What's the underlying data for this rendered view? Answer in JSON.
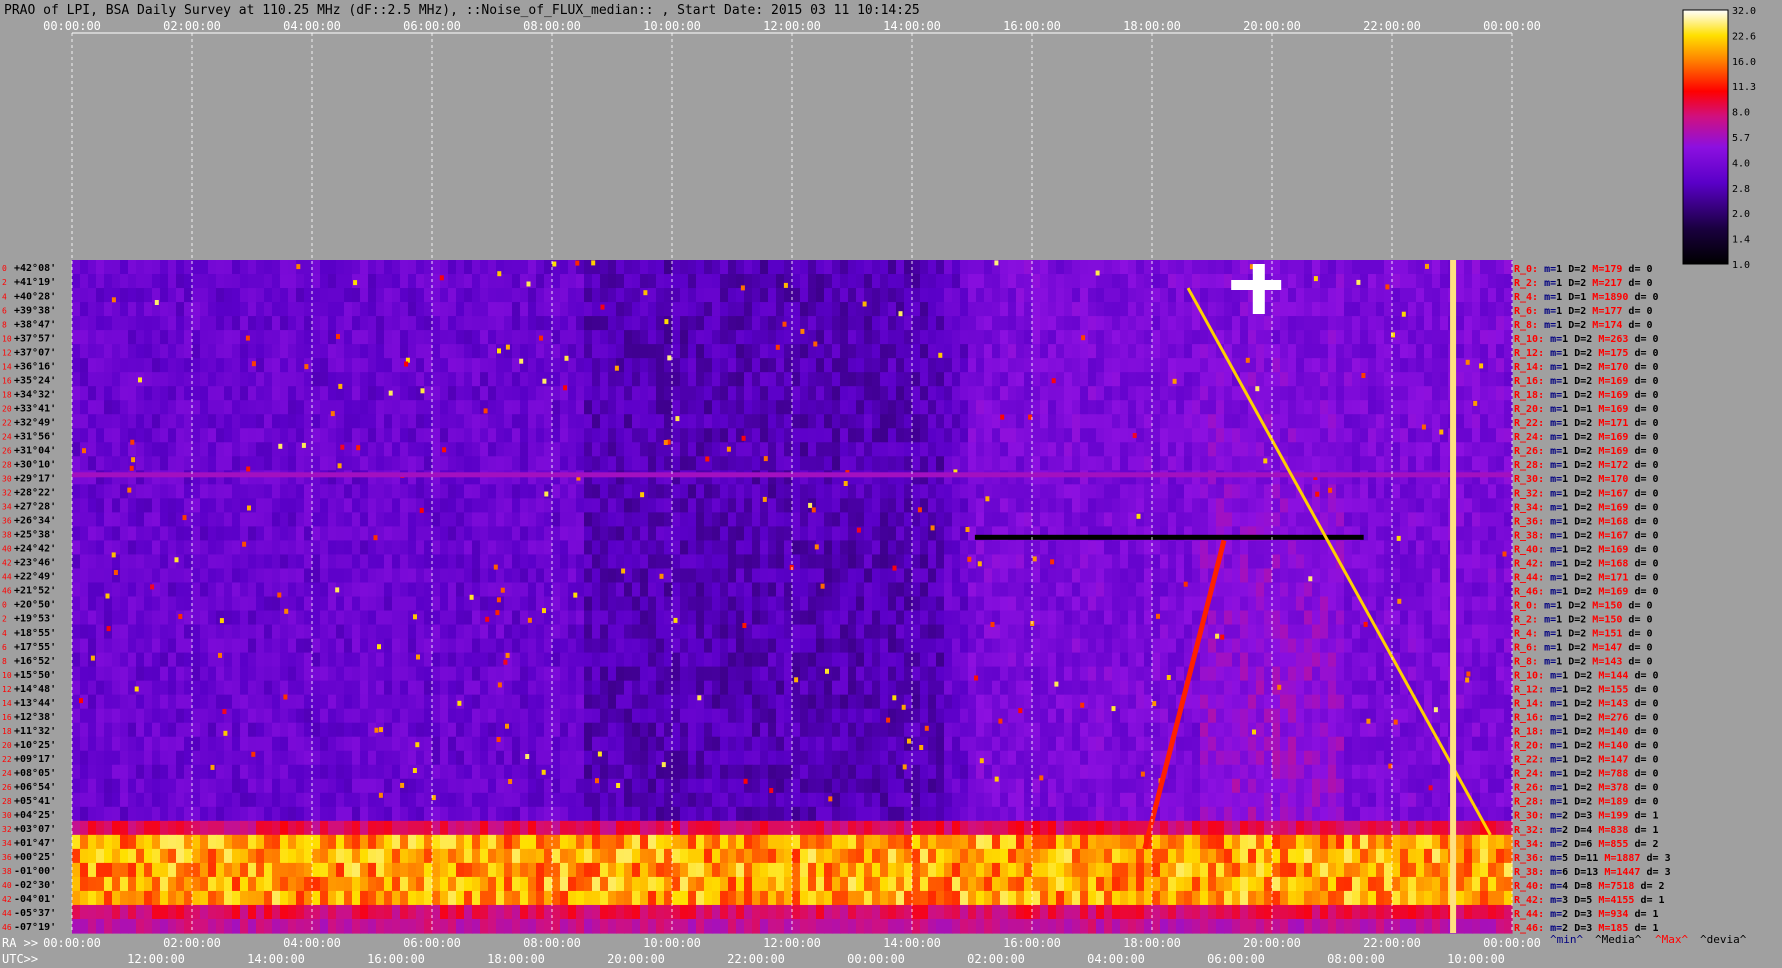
{
  "chart_data": {
    "type": "heatmap",
    "title": "PRAO of LPI, BSA Daily Survey at 110.25 MHz (dF::2.5 MHz), ::Noise_of_FLUX_median:: , Start Date: 2015 03 11 10:14:25",
    "x_top_ticks": [
      "00:00:00",
      "02:00:00",
      "04:00:00",
      "06:00:00",
      "08:00:00",
      "10:00:00",
      "12:00:00",
      "14:00:00",
      "16:00:00",
      "18:00:00",
      "20:00:00",
      "22:00:00",
      "00:00:00"
    ],
    "x_ra_label": "RA >>",
    "x_ra_ticks": [
      "00:00:00",
      "02:00:00",
      "04:00:00",
      "06:00:00",
      "08:00:00",
      "10:00:00",
      "12:00:00",
      "14:00:00",
      "16:00:00",
      "18:00:00",
      "20:00:00",
      "22:00:00",
      "00:00:00"
    ],
    "x_utc_label": "UTC>>",
    "x_utc_ticks": [
      "12:00:00",
      "14:00:00",
      "16:00:00",
      "18:00:00",
      "20:00:00",
      "22:00:00",
      "00:00:00",
      "02:00:00",
      "04:00:00",
      "06:00:00",
      "08:00:00",
      "10:00:00"
    ],
    "dec_labels": [
      "+42°08'",
      "+41°19'",
      "+40°28'",
      "+39°38'",
      "+38°47'",
      "+37°57'",
      "+37°07'",
      "+36°16'",
      "+35°24'",
      "+34°32'",
      "+33°41'",
      "+32°49'",
      "+31°56'",
      "+31°04'",
      "+30°10'",
      "+29°17'",
      "+28°22'",
      "+27°28'",
      "+26°34'",
      "+25°38'",
      "+24°42'",
      "+23°46'",
      "+22°49'",
      "+21°52'",
      "+20°50'",
      "+19°53'",
      "+18°55'",
      "+17°55'",
      "+16°52'",
      "+15°50'",
      "+14°48'",
      "+13°44'",
      "+12°38'",
      "+11°32'",
      "+10°25'",
      "+09°17'",
      "+08°05'",
      "+06°54'",
      "+05°41'",
      "+04°25'",
      "+03°07'",
      "+01°47'",
      "+00°25'",
      "-01°00'",
      "-02°30'",
      "-04°01'",
      "-05°37'",
      "-07°19'"
    ],
    "row_numbers": [
      "0",
      "2",
      "4",
      "6",
      "8",
      "10",
      "12",
      "14",
      "16",
      "18",
      "20",
      "22",
      "24",
      "26",
      "28",
      "30",
      "32",
      "34",
      "36",
      "38",
      "40",
      "42",
      "44",
      "46",
      "0",
      "2",
      "4",
      "6",
      "8",
      "10",
      "12",
      "14",
      "16",
      "18",
      "20",
      "22",
      "24",
      "26",
      "28",
      "30",
      "32",
      "34",
      "36",
      "38",
      "40",
      "42",
      "44",
      "46"
    ],
    "colorbar_ticks": [
      "32.0",
      "22.6",
      "16.0",
      "11.3",
      "8.0",
      "5.7",
      "4.0",
      "2.8",
      "2.0",
      "1.4",
      "1.0"
    ],
    "stats_rows": [
      {
        "r": "R_0:",
        "m": "1",
        "D": "2",
        "M": "179",
        "d": "0"
      },
      {
        "r": "R_2:",
        "m": "1",
        "D": "2",
        "M": "217",
        "d": "0"
      },
      {
        "r": "R_4:",
        "m": "1",
        "D": "1",
        "M": "1890",
        "d": "0"
      },
      {
        "r": "R_6:",
        "m": "1",
        "D": "2",
        "M": "177",
        "d": "0"
      },
      {
        "r": "R_8:",
        "m": "1",
        "D": "2",
        "M": "174",
        "d": "0"
      },
      {
        "r": "R_10:",
        "m": "1",
        "D": "2",
        "M": "263",
        "d": "0"
      },
      {
        "r": "R_12:",
        "m": "1",
        "D": "2",
        "M": "175",
        "d": "0"
      },
      {
        "r": "R_14:",
        "m": "1",
        "D": "2",
        "M": "170",
        "d": "0"
      },
      {
        "r": "R_16:",
        "m": "1",
        "D": "2",
        "M": "169",
        "d": "0"
      },
      {
        "r": "R_18:",
        "m": "1",
        "D": "2",
        "M": "169",
        "d": "0"
      },
      {
        "r": "R_20:",
        "m": "1",
        "D": "1",
        "M": "169",
        "d": "0"
      },
      {
        "r": "R_22:",
        "m": "1",
        "D": "2",
        "M": "171",
        "d": "0"
      },
      {
        "r": "R_24:",
        "m": "1",
        "D": "2",
        "M": "169",
        "d": "0"
      },
      {
        "r": "R_26:",
        "m": "1",
        "D": "2",
        "M": "169",
        "d": "0"
      },
      {
        "r": "R_28:",
        "m": "1",
        "D": "2",
        "M": "172",
        "d": "0"
      },
      {
        "r": "R_30:",
        "m": "1",
        "D": "2",
        "M": "170",
        "d": "0"
      },
      {
        "r": "R_32:",
        "m": "1",
        "D": "2",
        "M": "167",
        "d": "0"
      },
      {
        "r": "R_34:",
        "m": "1",
        "D": "2",
        "M": "169",
        "d": "0"
      },
      {
        "r": "R_36:",
        "m": "1",
        "D": "2",
        "M": "168",
        "d": "0"
      },
      {
        "r": "R_38:",
        "m": "1",
        "D": "2",
        "M": "167",
        "d": "0"
      },
      {
        "r": "R_40:",
        "m": "1",
        "D": "2",
        "M": "169",
        "d": "0"
      },
      {
        "r": "R_42:",
        "m": "1",
        "D": "2",
        "M": "168",
        "d": "0"
      },
      {
        "r": "R_44:",
        "m": "1",
        "D": "2",
        "M": "171",
        "d": "0"
      },
      {
        "r": "R_46:",
        "m": "1",
        "D": "2",
        "M": "169",
        "d": "0"
      },
      {
        "r": "R_0:",
        "m": "1",
        "D": "2",
        "M": "150",
        "d": "0"
      },
      {
        "r": "R_2:",
        "m": "1",
        "D": "2",
        "M": "150",
        "d": "0"
      },
      {
        "r": "R_4:",
        "m": "1",
        "D": "2",
        "M": "151",
        "d": "0"
      },
      {
        "r": "R_6:",
        "m": "1",
        "D": "2",
        "M": "147",
        "d": "0"
      },
      {
        "r": "R_8:",
        "m": "1",
        "D": "2",
        "M": "143",
        "d": "0"
      },
      {
        "r": "R_10:",
        "m": "1",
        "D": "2",
        "M": "144",
        "d": "0"
      },
      {
        "r": "R_12:",
        "m": "1",
        "D": "2",
        "M": "155",
        "d": "0"
      },
      {
        "r": "R_14:",
        "m": "1",
        "D": "2",
        "M": "143",
        "d": "0"
      },
      {
        "r": "R_16:",
        "m": "1",
        "D": "2",
        "M": "276",
        "d": "0"
      },
      {
        "r": "R_18:",
        "m": "1",
        "D": "2",
        "M": "140",
        "d": "0"
      },
      {
        "r": "R_20:",
        "m": "1",
        "D": "2",
        "M": "140",
        "d": "0"
      },
      {
        "r": "R_22:",
        "m": "1",
        "D": "2",
        "M": "147",
        "d": "0"
      },
      {
        "r": "R_24:",
        "m": "1",
        "D": "2",
        "M": "788",
        "d": "0"
      },
      {
        "r": "R_26:",
        "m": "1",
        "D": "2",
        "M": "378",
        "d": "0"
      },
      {
        "r": "R_28:",
        "m": "1",
        "D": "2",
        "M": "189",
        "d": "0"
      },
      {
        "r": "R_30:",
        "m": "2",
        "D": "3",
        "M": "199",
        "d": "1"
      },
      {
        "r": "R_32:",
        "m": "2",
        "D": "4",
        "M": "838",
        "d": "1"
      },
      {
        "r": "R_34:",
        "m": "2",
        "D": "6",
        "M": "855",
        "d": "2"
      },
      {
        "r": "R_36:",
        "m": "5",
        "D": "11",
        "M": "1887",
        "d": "3"
      },
      {
        "r": "R_38:",
        "m": "6",
        "D": "13",
        "M": "1447",
        "d": "3"
      },
      {
        "r": "R_40:",
        "m": "4",
        "D": "8",
        "M": "7518",
        "d": "2"
      },
      {
        "r": "R_42:",
        "m": "3",
        "D": "5",
        "M": "4155",
        "d": "1"
      },
      {
        "r": "R_44:",
        "m": "2",
        "D": "3",
        "M": "934",
        "d": "1"
      },
      {
        "r": "R_46:",
        "m": "2",
        "D": "3",
        "M": "185",
        "d": "1"
      }
    ],
    "stats_legend": {
      "min": "^min^",
      "median": "^Media^",
      "max": "^Max^",
      "devia": "^devia^"
    },
    "colors": {
      "background": "#a0a0a0",
      "stats_red": "#ff0000",
      "stats_dark": "#000080",
      "grid_line": "#ffffff"
    }
  }
}
